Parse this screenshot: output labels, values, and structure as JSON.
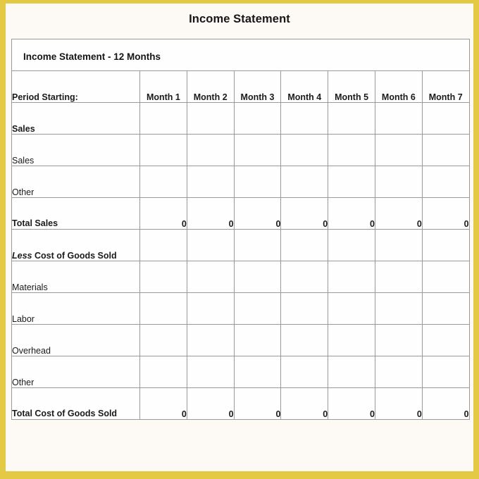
{
  "document": {
    "title": "Income Statement",
    "banner": "Income Statement - 12 Months",
    "watermark": ""
  },
  "colors": {
    "frame": "#e3c944",
    "banner_background": "#9b8f50",
    "page_background": "#fdfaf6",
    "grid_line": "#9a9a9a",
    "heavy_rule": "#1c1c1c",
    "text": "#1a1a1a"
  },
  "table": {
    "period_label": "Period Starting:",
    "columns": [
      "Month 1",
      "Month 2",
      "Month 3",
      "Month 4",
      "Month 5",
      "Month 6",
      "Month 7"
    ],
    "rows": [
      {
        "label": "Sales",
        "type": "section",
        "values": [
          "",
          "",
          "",
          "",
          "",
          "",
          ""
        ]
      },
      {
        "label": "Sales",
        "type": "item",
        "values": [
          "",
          "",
          "",
          "",
          "",
          "",
          ""
        ]
      },
      {
        "label": "Other",
        "type": "item",
        "values": [
          "",
          "",
          "",
          "",
          "",
          "",
          ""
        ]
      },
      {
        "label": "Total Sales",
        "type": "total",
        "values": [
          "0",
          "0",
          "0",
          "0",
          "0",
          "0",
          "0"
        ]
      },
      {
        "label": "Less Cost of Goods Sold",
        "label_emphasis": "Less",
        "label_rest": " Cost of Goods Sold",
        "type": "section",
        "values": [
          "",
          "",
          "",
          "",
          "",
          "",
          ""
        ]
      },
      {
        "label": "Materials",
        "type": "item",
        "values": [
          "",
          "",
          "",
          "",
          "",
          "",
          ""
        ]
      },
      {
        "label": "Labor",
        "type": "item",
        "values": [
          "",
          "",
          "",
          "",
          "",
          "",
          ""
        ]
      },
      {
        "label": "Overhead",
        "type": "item",
        "values": [
          "",
          "",
          "",
          "",
          "",
          "",
          ""
        ]
      },
      {
        "label": "Other",
        "type": "item",
        "values": [
          "",
          "",
          "",
          "",
          "",
          "",
          ""
        ]
      },
      {
        "label": "Total Cost of Goods Sold",
        "type": "total",
        "values": [
          "0",
          "0",
          "0",
          "0",
          "0",
          "0",
          "0"
        ]
      }
    ]
  }
}
